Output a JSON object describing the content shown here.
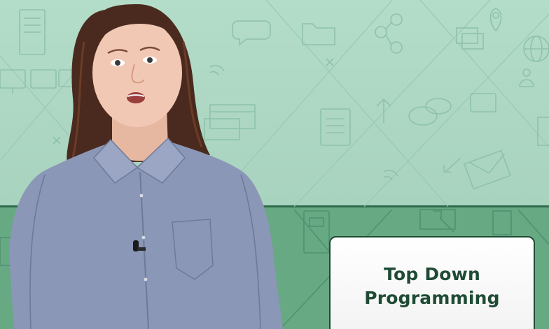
{
  "video_frame": {
    "title_card": {
      "line1": "Top Down",
      "line2": "Programming"
    },
    "colors": {
      "background_upper": "#b3dcc9",
      "background_lower": "#66a983",
      "divider": "#2f6b4b",
      "card_background": "#ffffff",
      "card_text": "#1f4b35"
    },
    "background_icons": [
      "document-icon",
      "monitor-icon",
      "folder-icon",
      "chat-bubble-icon",
      "network-icon",
      "map-pin-icon",
      "globe-icon",
      "wifi-icon",
      "envelope-icon",
      "arrow-icon",
      "window-stack-icon",
      "user-icon"
    ]
  }
}
